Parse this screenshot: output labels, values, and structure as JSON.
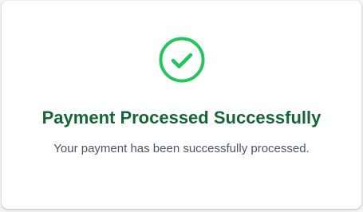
{
  "status": {
    "icon": "check-circle-icon",
    "icon_color": "#22c55e",
    "title": "Payment Processed Successfully",
    "title_color": "#166534",
    "message": "Your payment has been successfully processed.",
    "message_color": "#4b5563"
  }
}
